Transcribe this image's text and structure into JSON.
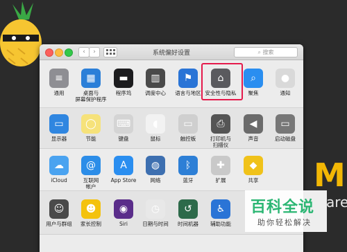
{
  "window": {
    "title": "系统偏好设置",
    "search_placeholder": "搜索",
    "back_label": "‹",
    "forward_label": "›"
  },
  "rows": [
    [
      {
        "label": "通用",
        "icon": "general-icon"
      },
      {
        "label": "桌面与\n屏幕保护程序",
        "icon": "desktop-icon"
      },
      {
        "label": "程序坞",
        "icon": "dock-icon"
      },
      {
        "label": "调度中心",
        "icon": "mission-control-icon"
      },
      {
        "label": "语言与地区",
        "icon": "language-icon"
      },
      {
        "label": "安全性与隐私",
        "icon": "security-icon"
      },
      {
        "label": "聚焦",
        "icon": "spotlight-icon"
      },
      {
        "label": "通知",
        "icon": "notifications-icon"
      }
    ],
    [
      {
        "label": "显示器",
        "icon": "display-icon"
      },
      {
        "label": "节能",
        "icon": "energy-icon"
      },
      {
        "label": "键盘",
        "icon": "keyboard-icon"
      },
      {
        "label": "鼠标",
        "icon": "mouse-icon"
      },
      {
        "label": "触控板",
        "icon": "trackpad-icon"
      },
      {
        "label": "打印机与\n扫描仪",
        "icon": "printer-icon"
      },
      {
        "label": "声音",
        "icon": "sound-icon"
      },
      {
        "label": "启动磁盘",
        "icon": "startup-disk-icon"
      }
    ],
    [
      {
        "label": "iCloud",
        "icon": "icloud-icon"
      },
      {
        "label": "互联网\n帐户",
        "icon": "internet-accounts-icon"
      },
      {
        "label": "App Store",
        "icon": "appstore-icon"
      },
      {
        "label": "网络",
        "icon": "network-icon"
      },
      {
        "label": "蓝牙",
        "icon": "bluetooth-icon"
      },
      {
        "label": "扩展",
        "icon": "extensions-icon"
      },
      {
        "label": "共享",
        "icon": "sharing-icon"
      }
    ],
    [
      {
        "label": "用户与群组",
        "icon": "users-icon"
      },
      {
        "label": "家长控制",
        "icon": "parental-icon"
      },
      {
        "label": "Siri",
        "icon": "siri-icon"
      },
      {
        "label": "日期与时间",
        "icon": "datetime-icon"
      },
      {
        "label": "时间机器",
        "icon": "timemachine-icon"
      },
      {
        "label": "辅助功能",
        "icon": "accessibility-icon"
      }
    ]
  ],
  "background": {
    "letter": "M",
    "tail": "are"
  },
  "watermark": {
    "title": "百科全说",
    "subtitle": "助你轻松解决"
  },
  "colors": {
    "highlight": "#e5194b",
    "accent": "#2bb673"
  }
}
